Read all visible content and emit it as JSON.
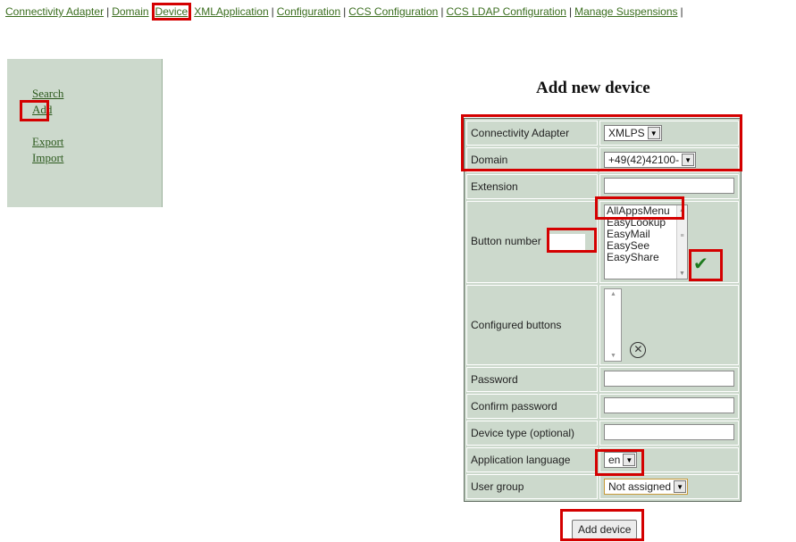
{
  "topnav": {
    "items": [
      "Connectivity Adapter",
      "Domain",
      "Device",
      "XMLApplication",
      "Configuration",
      "CCS Configuration",
      "CCS LDAP Configuration",
      "Manage Suspensions"
    ]
  },
  "sidebar": {
    "search": "Search",
    "add": "Add",
    "export": "Export",
    "import": "Import"
  },
  "title": "Add new device",
  "form": {
    "connectivity_adapter": {
      "label": "Connectivity Adapter",
      "value": "XMLPS"
    },
    "domain": {
      "label": "Domain",
      "value": "+49(42)42100-"
    },
    "extension": {
      "label": "Extension"
    },
    "button_number": {
      "label": "Button number",
      "options": [
        "AllAppsMenu",
        "EasyLookup",
        "EasyMail",
        "EasySee",
        "EasyShare"
      ]
    },
    "configured_buttons": {
      "label": "Configured buttons"
    },
    "password": {
      "label": "Password"
    },
    "confirm_password": {
      "label": "Confirm password"
    },
    "device_type": {
      "label": "Device type (optional)"
    },
    "application_language": {
      "label": "Application language",
      "value": "en"
    },
    "user_group": {
      "label": "User group",
      "value": "Not assigned"
    }
  },
  "submit_label": "Add device",
  "colors": {
    "highlight": "#d40000",
    "panel": "#ccd9cc",
    "link": "#3b6e1f"
  }
}
